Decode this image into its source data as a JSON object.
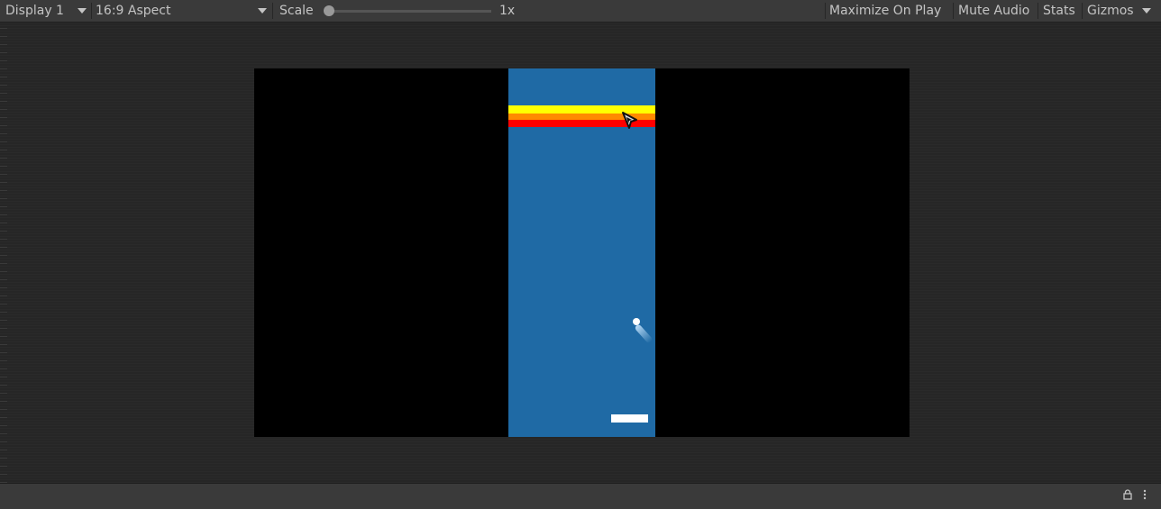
{
  "toolbar": {
    "display_label": "Display 1",
    "aspect_label": "16:9 Aspect",
    "scale_label": "Scale",
    "scale_value": "1x",
    "scale_level": 0,
    "maximize_label": "Maximize On Play",
    "mute_label": "Mute Audio",
    "stats_label": "Stats",
    "gizmos_label": "Gizmos"
  },
  "game": {
    "letterbox_color": "#000000",
    "playfield_color": "#1f6aa5",
    "brick_rows": [
      {
        "color": "#ffff00"
      },
      {
        "color": "#ff8a00"
      },
      {
        "color": "#ff0000"
      }
    ],
    "paddle_color": "#ffffff",
    "ball_color": "#ffffff"
  },
  "statusbar": {
    "lock_icon": "lock-icon",
    "menu_icon": "kebab-menu-icon"
  }
}
